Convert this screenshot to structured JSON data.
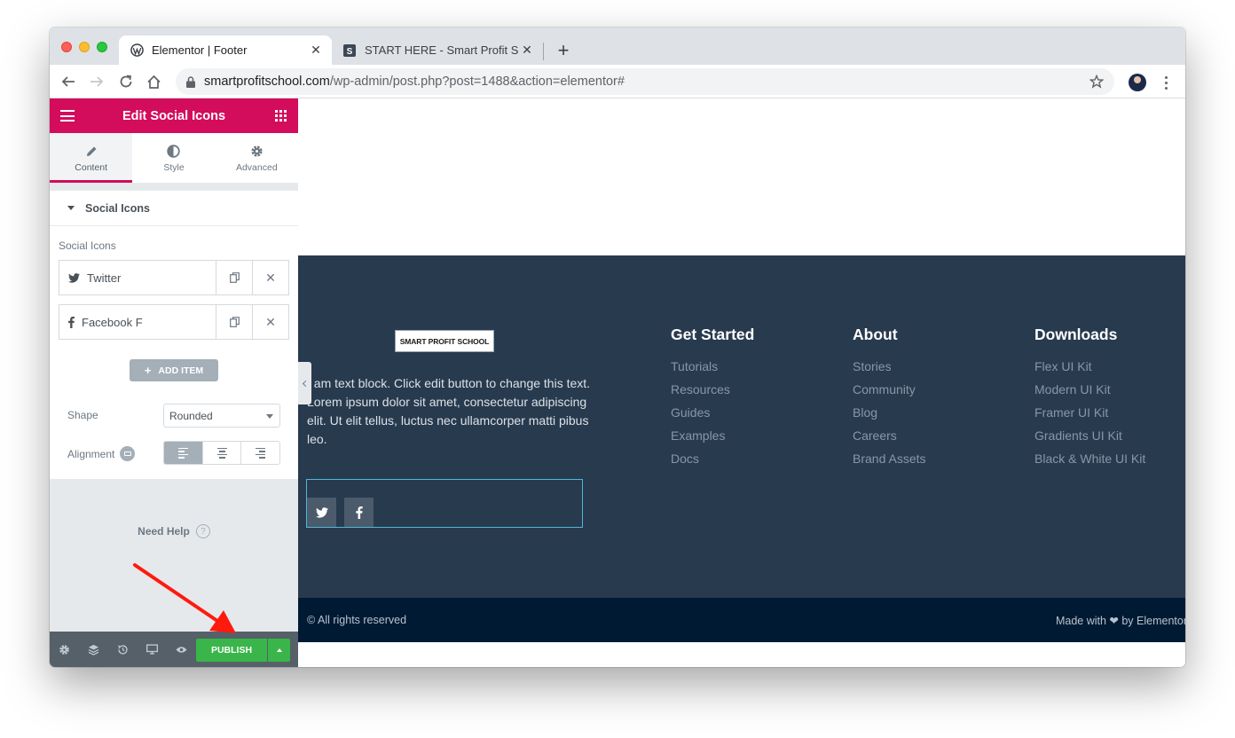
{
  "browser": {
    "tabs": [
      {
        "title": "Elementor | Footer",
        "active": true
      },
      {
        "title": "START HERE - Smart Profit Sc",
        "active": false,
        "favicon": "S"
      }
    ],
    "url_host": "smartprofitschool.com",
    "url_path": "/wp-admin/post.php?post=1488&action=elementor#"
  },
  "panel": {
    "title": "Edit Social Icons",
    "tabs": [
      {
        "label": "Content",
        "icon": "pencil-icon"
      },
      {
        "label": "Style",
        "icon": "contrast-icon"
      },
      {
        "label": "Advanced",
        "icon": "gear-icon"
      }
    ],
    "section_title": "Social Icons",
    "field_label": "Social Icons",
    "items": [
      {
        "label": "Twitter",
        "icon": "twitter-icon"
      },
      {
        "label": "Facebook F",
        "icon": "facebook-icon"
      }
    ],
    "add_item_label": "ADD ITEM",
    "shape_label": "Shape",
    "shape_value": "Rounded",
    "alignment_label": "Alignment",
    "need_help": "Need Help",
    "publish_label": "PUBLISH"
  },
  "footer": {
    "logo_text": "SMART PROFIT SCHOOL",
    "text_block": "I am text block. Click edit button to change this text. Lorem ipsum dolor sit amet, consectetur adipiscing elit. Ut elit tellus, luctus nec ullamcorper matti pibus leo.",
    "columns": [
      {
        "title": "Get Started",
        "links": [
          "Tutorials",
          "Resources",
          "Guides",
          "Examples",
          "Docs"
        ]
      },
      {
        "title": "About",
        "links": [
          "Stories",
          "Community",
          "Blog",
          "Careers",
          "Brand Assets"
        ]
      },
      {
        "title": "Downloads",
        "links": [
          "Flex UI Kit",
          "Modern UI Kit",
          "Framer UI Kit",
          "Gradients UI Kit",
          "Black & White UI Kit"
        ]
      }
    ],
    "copyright": "© All rights reserved",
    "made_with": "Made with ❤ by Elementor"
  },
  "colors": {
    "elementor_brand": "#d30c5c",
    "publish_green": "#39b54a",
    "footer_bg": "#283a4e",
    "footer_bar_bg": "#011a34",
    "arrow_red": "#ff1a0e"
  }
}
